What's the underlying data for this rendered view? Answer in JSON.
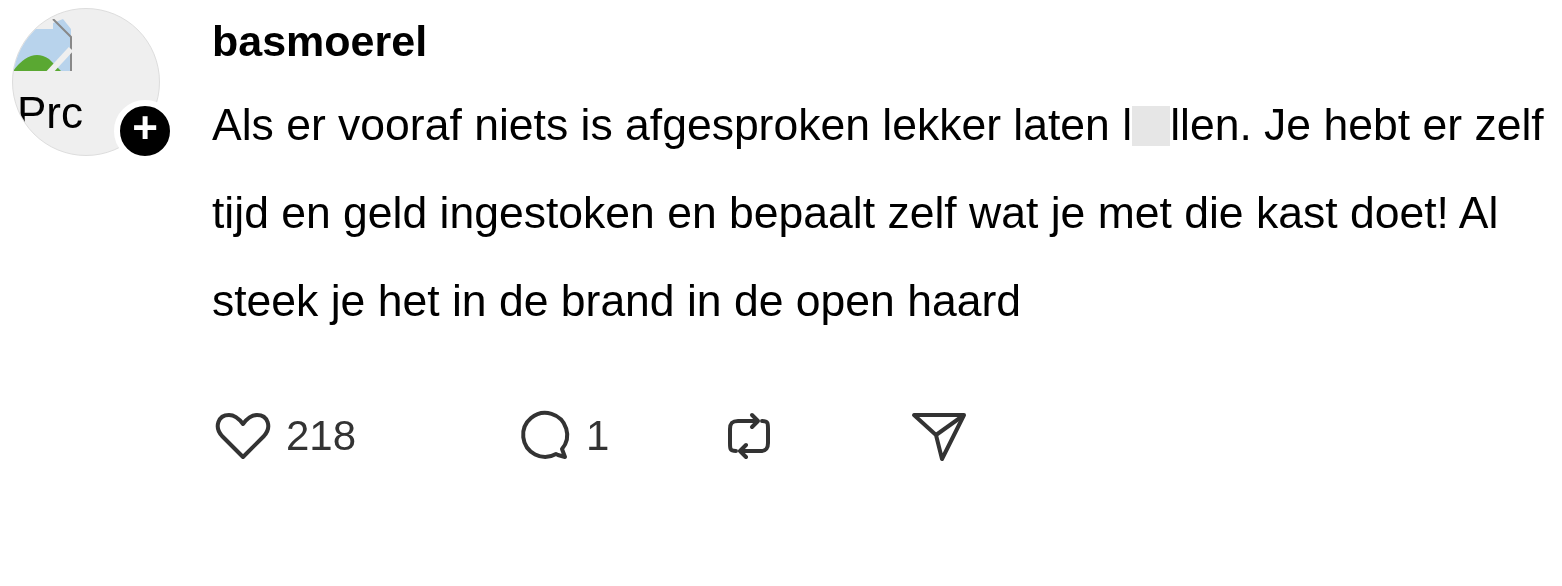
{
  "post": {
    "avatar": {
      "alt_text": "Prc",
      "follow_badge": "+"
    },
    "username": "basmoerel",
    "body_parts": [
      {
        "kind": "text",
        "text": "Als er vooraf niets is afgesproken lekker laten l"
      },
      {
        "kind": "redaction"
      },
      {
        "kind": "text",
        "text": "llen. Je hebt er zelf tijd en geld ingestoken en bepaalt zelf wat je met die kast doet! Al steek je het in de brand in de open haard"
      }
    ],
    "actions": [
      {
        "kind": "like",
        "count": "218"
      },
      {
        "kind": "reply",
        "count": "1"
      },
      {
        "kind": "repost"
      },
      {
        "kind": "share"
      }
    ]
  }
}
